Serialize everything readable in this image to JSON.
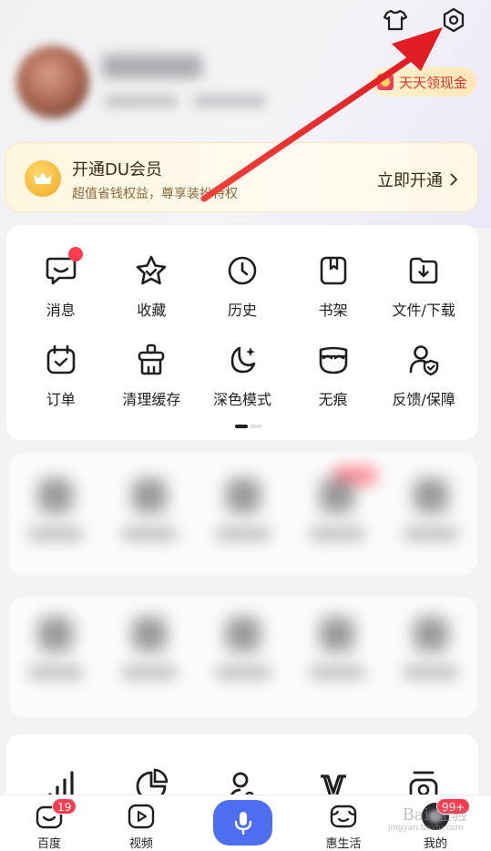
{
  "header": {
    "icons": [
      "shirt-icon",
      "gear-icon"
    ]
  },
  "profile": {
    "cash_label": "天天领现金"
  },
  "vip": {
    "title": "开通DU会员",
    "subtitle": "超值省钱权益，尊享装扮特权",
    "cta": "立即开通"
  },
  "grid": {
    "items": [
      {
        "label": "消息",
        "icon": "message-icon",
        "badge": true
      },
      {
        "label": "收藏",
        "icon": "star-icon"
      },
      {
        "label": "历史",
        "icon": "clock-icon"
      },
      {
        "label": "书架",
        "icon": "bookshelf-icon"
      },
      {
        "label": "文件/下载",
        "icon": "download-icon"
      },
      {
        "label": "订单",
        "icon": "order-icon"
      },
      {
        "label": "清理缓存",
        "icon": "clean-cache-icon"
      },
      {
        "label": "深色模式",
        "icon": "moon-icon"
      },
      {
        "label": "无痕",
        "icon": "mask-icon"
      },
      {
        "label": "反馈/保障",
        "icon": "feedback-shield-icon"
      }
    ]
  },
  "tabbar": {
    "tabs": [
      {
        "label": "百度",
        "icon": "baidu-home-icon",
        "badge": "19"
      },
      {
        "label": "视频",
        "icon": "video-icon"
      },
      {
        "label": "",
        "icon": "mic-icon"
      },
      {
        "label": "惠生活",
        "icon": "life-icon"
      },
      {
        "label": "我的",
        "icon": "me-avatar",
        "badge": "99+"
      }
    ]
  },
  "watermark": {
    "text": "Bai 经验",
    "sub": "jingyan.baidu.com"
  },
  "colors": {
    "accent_blue": "#4e6ef2",
    "badge_red": "#ff3b4e",
    "annotation_arrow": "#e8262a",
    "vip_gold": "#f2a821"
  }
}
